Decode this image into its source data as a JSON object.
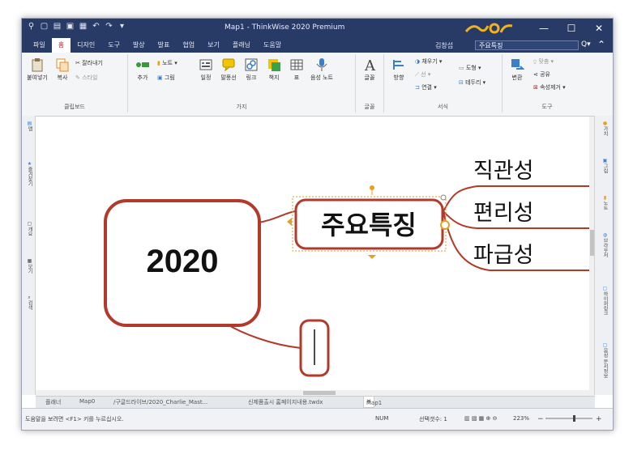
{
  "titlebar": {
    "title": "Map1 - ThinkWise 2020 Premium",
    "minimize": "—",
    "maximize": "☐",
    "close": "✕"
  },
  "menu": {
    "items": [
      "파일",
      "홈",
      "디자인",
      "도구",
      "발상",
      "발표",
      "협업",
      "보기",
      "플래닝",
      "도움말"
    ],
    "active": "홈",
    "user": "김창섭",
    "search_value": "주요특징"
  },
  "ribbon": {
    "clipboard": {
      "label": "클립보드",
      "paste": "붙여넣기",
      "copy": "복사",
      "cut": "잘라내기",
      "style": "스타일"
    },
    "branch": {
      "label": "가지",
      "add": "추가",
      "note": "노트",
      "picture": "그림",
      "outline": "일정",
      "callout": "말풍선",
      "link": "링크",
      "attach": "책지",
      "table": "표",
      "voice_note": "음성 노트"
    },
    "font": {
      "label": "글꼴",
      "font": "글꼴"
    },
    "format": {
      "label": "서식",
      "direction": "방향",
      "fill": "채우기",
      "line": "선",
      "connect": "연결",
      "shape": "도형",
      "border": "테두리"
    },
    "tools": {
      "label": "도구",
      "convert": "변환",
      "spell": "맞춤",
      "share": "공유",
      "clear_attr": "속성제거"
    }
  },
  "leftpanel": [
    "맵",
    "즐겨찾기",
    "개요",
    "보기",
    "검색"
  ],
  "rightpanel": [
    "가치",
    "그림",
    "노트",
    "브라우저",
    "하이퍼링크",
    "음성 문서정보"
  ],
  "map": {
    "central": "2020",
    "main_topic": "주요특징",
    "subtopics": [
      "직관성",
      "편리성",
      "파급성"
    ],
    "empty_topic_cursor": "|"
  },
  "tabs": [
    "플래너",
    "Map0",
    "/구글드라이브/2020_Charlie_Mast...",
    "신제품출시 홈페이지내용.twdx",
    "Map1"
  ],
  "active_tab": "Map1",
  "status": {
    "help": "도움말을 보려면 <F1> 키를 누르십시오.",
    "num": "NUM",
    "selected": "선택갯수: 1",
    "zoom": "223%"
  },
  "colors": {
    "titlebar": "#283a66",
    "accent": "#c62828",
    "branch": "#b23a2a",
    "logo": "#f2b21d"
  }
}
